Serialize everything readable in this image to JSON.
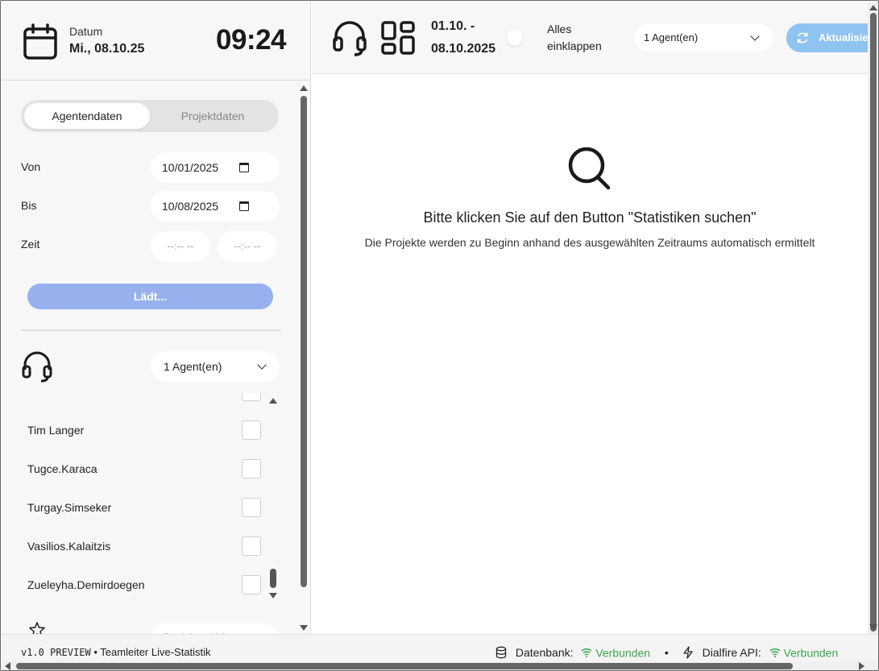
{
  "header": {
    "date_label": "Datum",
    "date_value": "Mi., 08.10.25",
    "time": "09:24",
    "range_line1": "01.10. -",
    "range_line2": "08.10.2025",
    "collapse_line1": "Alles",
    "collapse_line2": "einklappen",
    "agent_select": "1 Agent(en)",
    "refresh_label": "Aktualisieren"
  },
  "sidebar": {
    "tabs": [
      {
        "label": "Agentendaten",
        "active": true
      },
      {
        "label": "Projektdaten",
        "active": false
      }
    ],
    "from_label": "Von",
    "from_value": "10/01/2025",
    "to_label": "Bis",
    "to_value": "10/08/2025",
    "time_label": "Zeit",
    "time_from_placeholder": "--:-- --",
    "time_to_placeholder": "--:-- --",
    "load_button": "Lädt...",
    "agent_select": "1 Agent(en)",
    "agents": [
      {
        "name": "Tim Langer",
        "checked": false
      },
      {
        "name": "Tugce.Karaca",
        "checked": false
      },
      {
        "name": "Turgay.Simseker",
        "checked": false
      },
      {
        "name": "Vasilios.Kalaitzis",
        "checked": false
      },
      {
        "name": "Zueleyha.Demirdoegen",
        "checked": false
      }
    ],
    "project_select_placeholder": "Projekt wählen"
  },
  "main": {
    "empty_title": "Bitte klicken Sie auf den Button \"Statistiken suchen\"",
    "empty_subtitle": "Die Projekte werden zu Beginn anhand des ausgewählten Zeitraums automatisch ermittelt"
  },
  "footer": {
    "version": "v1.0 PREVIEW",
    "separator": "•",
    "app_name": "Teamleiter Live-Statistik",
    "db_label": "Datenbank:",
    "db_status": "Verbunden",
    "api_label": "Dialfire API:",
    "api_status": "Verbunden"
  },
  "colors": {
    "load_button": "#98b1ee",
    "refresh_button": "#90c4f0",
    "status_ok": "#3aa84e"
  }
}
